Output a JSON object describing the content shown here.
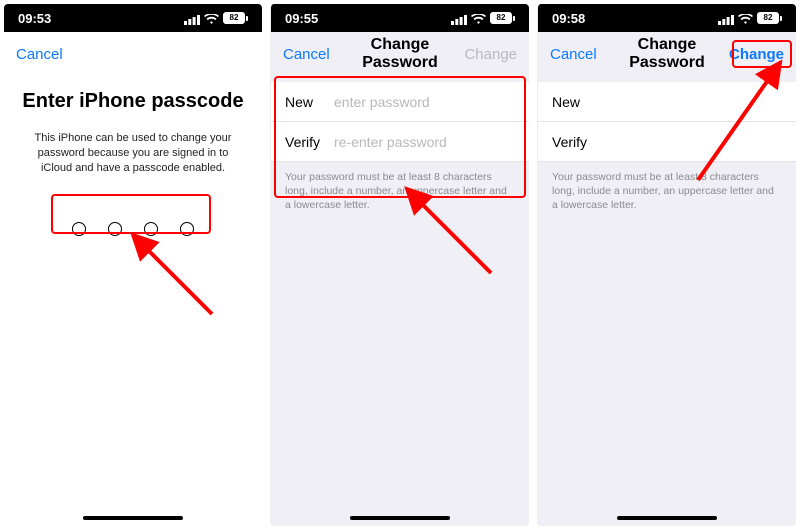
{
  "screens": {
    "s1": {
      "time": "09:53",
      "battery": "82",
      "nav_cancel": "Cancel",
      "title": "Enter iPhone passcode",
      "description": "This iPhone can be used to change your password because you are signed in to iCloud and have a passcode enabled."
    },
    "s2": {
      "time": "09:55",
      "battery": "82",
      "nav_cancel": "Cancel",
      "nav_title": "Change Password",
      "nav_change": "Change",
      "rows": {
        "new_label": "New",
        "new_placeholder": "enter password",
        "verify_label": "Verify",
        "verify_placeholder": "re-enter password"
      },
      "note": "Your password must be at least 8 characters long, include a number, an uppercase letter and a lowercase letter."
    },
    "s3": {
      "time": "09:58",
      "battery": "82",
      "nav_cancel": "Cancel",
      "nav_title": "Change Password",
      "nav_change": "Change",
      "rows": {
        "new_label": "New",
        "verify_label": "Verify"
      },
      "note": "Your password must be at least 8 characters long, include a number, an uppercase letter and a lowercase letter."
    }
  },
  "annotation_color": "#ff0000"
}
